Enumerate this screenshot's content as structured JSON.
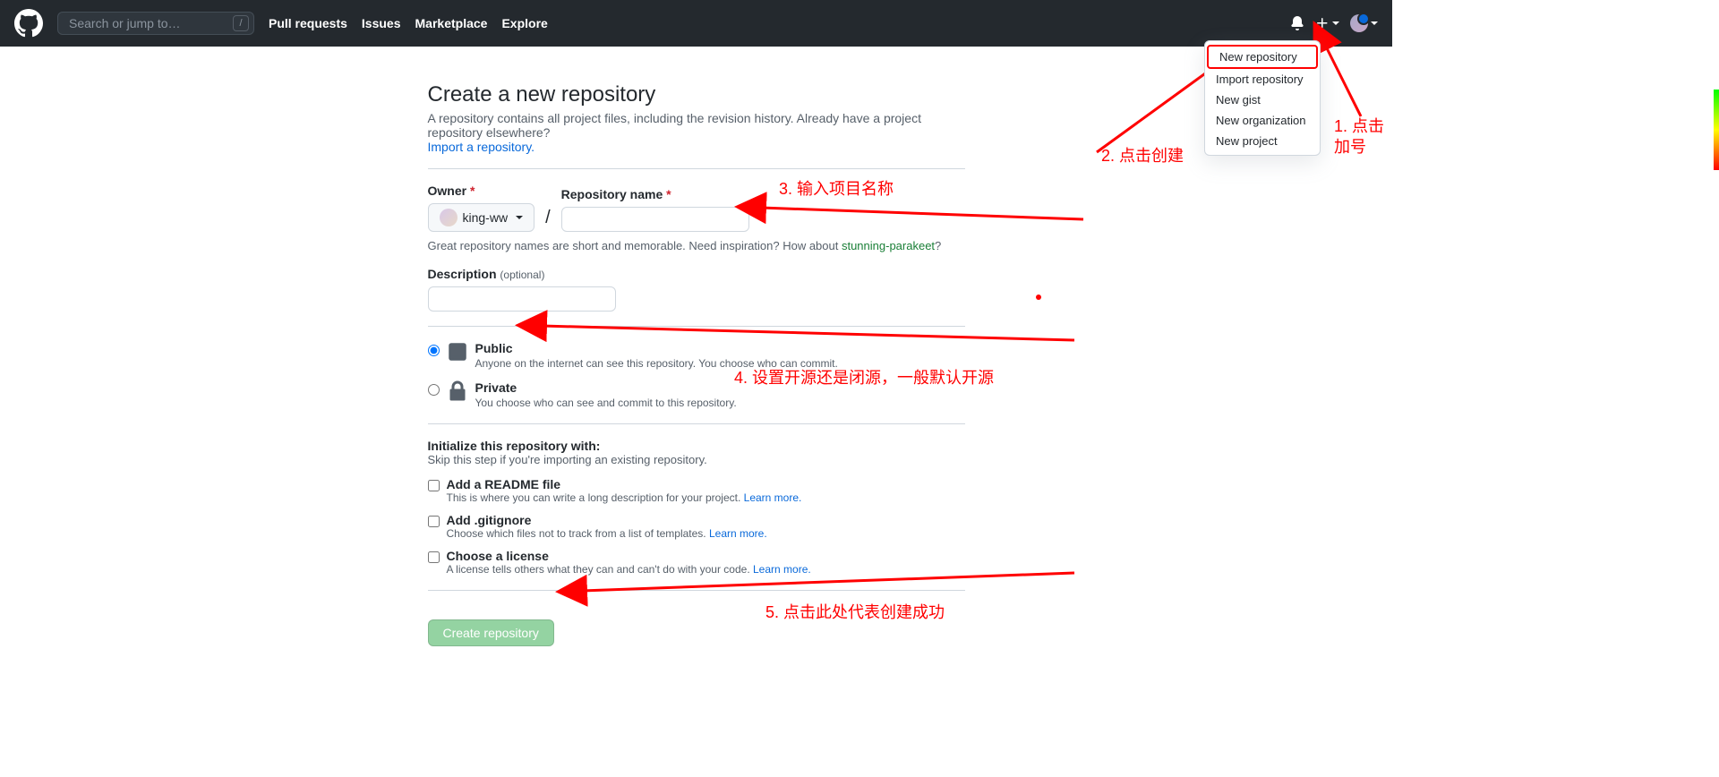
{
  "header": {
    "search_placeholder": "Search or jump to…",
    "links": [
      "Pull requests",
      "Issues",
      "Marketplace",
      "Explore"
    ]
  },
  "dropdown": {
    "items": [
      "New repository",
      "Import repository",
      "New gist",
      "New organization",
      "New project"
    ]
  },
  "page": {
    "title": "Create a new repository",
    "subtext": "A repository contains all project files, including the revision history. Already have a project repository elsewhere? ",
    "import_link": "Import a repository.",
    "owner_label": "Owner",
    "owner_name": "king-ww",
    "repo_label": "Repository name",
    "hint_prefix": "Great repository names are short and memorable. Need inspiration? How about ",
    "hint_suggest": "stunning-parakeet",
    "desc_label": "Description",
    "optional": "(optional)",
    "public_title": "Public",
    "public_desc": "Anyone on the internet can see this repository. You choose who can commit.",
    "private_title": "Private",
    "private_desc": "You choose who can see and commit to this repository.",
    "init_head": "Initialize this repository with:",
    "init_sub": "Skip this step if you're importing an existing repository.",
    "readme_title": "Add a README file",
    "readme_desc": "This is where you can write a long description for your project. ",
    "gitignore_title": "Add .gitignore",
    "gitignore_desc": "Choose which files not to track from a list of templates. ",
    "license_title": "Choose a license",
    "license_desc": "A license tells others what they can and can't do with your code. ",
    "learn_more": "Learn more.",
    "create_btn": "Create repository"
  },
  "annotations": {
    "a1": "1. 点击加号",
    "a2": "2. 点击创建",
    "a3": "3. 输入项目名称",
    "a4": "4. 设置开源还是闭源，一般默认开源",
    "a5": "5. 点击此处代表创建成功"
  }
}
